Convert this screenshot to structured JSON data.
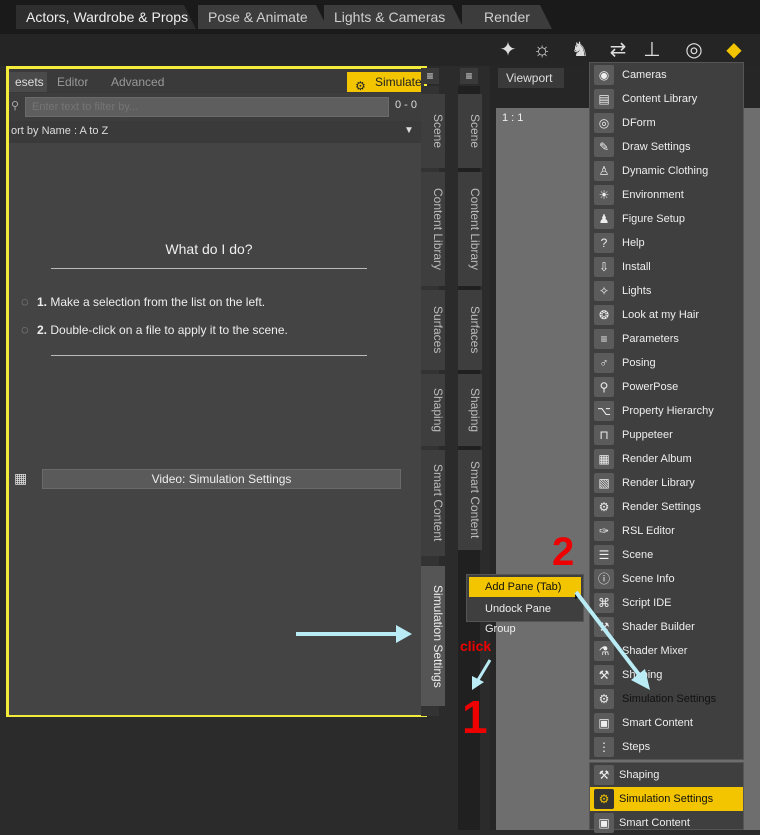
{
  "top_tabs": [
    "Actors, Wardrobe & Props",
    "Pose & Animate",
    "Lights & Cameras",
    "Render"
  ],
  "left_panel": {
    "tabs": [
      "esets",
      "Editor",
      "Advanced"
    ],
    "simulate_label": "Simulate",
    "filter_placeholder": "Enter text to filter by...",
    "filter_count": "0 - 0",
    "sort_label": "ort by Name : A to Z",
    "what_title": "What do I do?",
    "step1_num": "1.",
    "step1_text": "Make a selection from the list on the left.",
    "step2_num": "2.",
    "step2_text": "Double-click on a file to apply it to the scene.",
    "video_button": "Video: Simulation Settings"
  },
  "side_tabs_inner": [
    "Scene",
    "Content Library",
    "Surfaces",
    "Shaping",
    "Smart Content",
    "Simulation Settings"
  ],
  "side_tabs_outer": [
    "Scene",
    "Content Library",
    "Surfaces",
    "Shaping",
    "Smart Content"
  ],
  "viewport": {
    "tab": "Viewport",
    "ratio": "1 : 1"
  },
  "context_menu": {
    "add_pane": "Add Pane (Tab)",
    "undock": "Undock Pane Group"
  },
  "pane_menu": [
    {
      "label": "Cameras",
      "icon": "camera-icon"
    },
    {
      "label": "Content Library",
      "icon": "book-icon"
    },
    {
      "label": "DForm",
      "icon": "dform-icon"
    },
    {
      "label": "Draw Settings",
      "icon": "draw-icon"
    },
    {
      "label": "Dynamic Clothing",
      "icon": "shirt-icon"
    },
    {
      "label": "Environment",
      "icon": "sun-icon"
    },
    {
      "label": "Figure Setup",
      "icon": "figure-icon"
    },
    {
      "label": "Help",
      "icon": "help-icon"
    },
    {
      "label": "Install",
      "icon": "install-icon"
    },
    {
      "label": "Lights",
      "icon": "light-icon"
    },
    {
      "label": "Look at my Hair",
      "icon": "hair-icon"
    },
    {
      "label": "Parameters",
      "icon": "sliders-icon"
    },
    {
      "label": "Posing",
      "icon": "pose-icon"
    },
    {
      "label": "PowerPose",
      "icon": "powerpose-icon"
    },
    {
      "label": "Property Hierarchy",
      "icon": "hierarchy-icon"
    },
    {
      "label": "Puppeteer",
      "icon": "puppeteer-icon"
    },
    {
      "label": "Render Album",
      "icon": "album-icon"
    },
    {
      "label": "Render Library",
      "icon": "render-library-icon"
    },
    {
      "label": "Render Settings",
      "icon": "render-settings-icon"
    },
    {
      "label": "RSL Editor",
      "icon": "rsl-icon"
    },
    {
      "label": "Scene",
      "icon": "scene-icon"
    },
    {
      "label": "Scene Info",
      "icon": "info-icon"
    },
    {
      "label": "Script IDE",
      "icon": "script-icon"
    },
    {
      "label": "Shader Builder",
      "icon": "shader-builder-icon"
    },
    {
      "label": "Shader Mixer",
      "icon": "shader-mixer-icon"
    },
    {
      "label": "Shaping",
      "icon": "shaping-icon"
    },
    {
      "label": "Simulation Settings",
      "icon": "simulation-icon"
    },
    {
      "label": "Smart Content",
      "icon": "smart-content-icon"
    },
    {
      "label": "Steps",
      "icon": "steps-icon"
    }
  ],
  "bottom_menu": [
    "Shaping",
    "Simulation Settings",
    "Smart Content"
  ],
  "annotations": {
    "num1": "1",
    "num2": "2",
    "click": "click"
  },
  "colors": {
    "highlight": "#f2c500",
    "outline": "#f4ec3b",
    "arrow": "#b9ecf5",
    "annotation_red": "#e00000"
  }
}
